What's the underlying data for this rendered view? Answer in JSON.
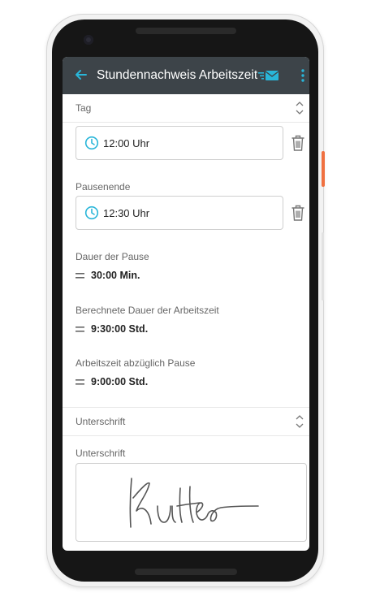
{
  "app_bar": {
    "title": "Stundennachweis Arbeitszeit",
    "icons": [
      "arrow-back-icon",
      "mail-send-icon",
      "more-vert-icon"
    ]
  },
  "sections": {
    "tag": {
      "label": "Tag"
    },
    "unterschrift": {
      "label": "Unterschrift"
    }
  },
  "fields": {
    "pausenbeginn": {
      "value": "12:00 Uhr"
    },
    "pausenende": {
      "label": "Pausenende",
      "value": "12:30 Uhr"
    },
    "dauer_pause": {
      "label": "Dauer der Pause",
      "value": "30:00 Min."
    },
    "berechnete_dauer": {
      "label": "Berechnete Dauer der Arbeitszeit",
      "value": "9:30:00 Std."
    },
    "arbeitszeit_abzueglich": {
      "label": "Arbeitszeit abzüglich Pause",
      "value": "9:00:00 Std."
    },
    "signature": {
      "label": "Unterschrift"
    }
  },
  "colors": {
    "app_bar": "#3d4449",
    "accent": "#29b6d9",
    "side_button": "#f07040"
  }
}
